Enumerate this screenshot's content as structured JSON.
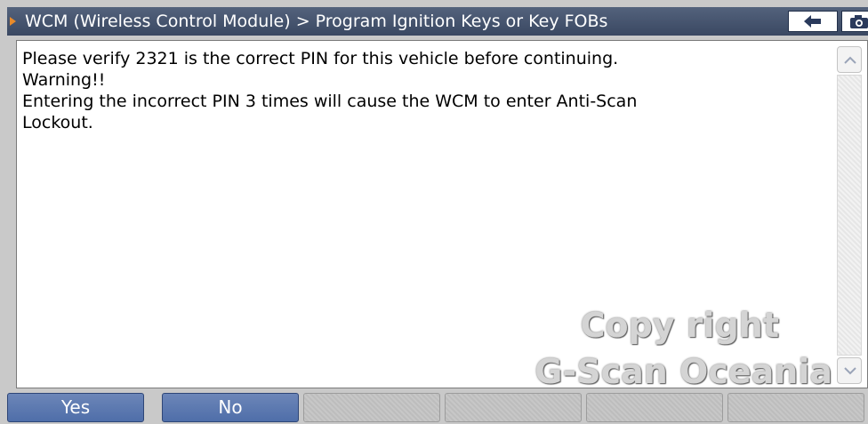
{
  "titlebar": {
    "title": "WCM (Wireless Control Module) > Program Ignition Keys or Key FOBs",
    "back_icon": "arrow-left-icon",
    "camera_icon": "camera-icon"
  },
  "message": {
    "lines": [
      "Please verify 2321 is the correct PIN for this vehicle before continuing.",
      "Warning!!",
      "Entering the incorrect PIN 3 times will cause the WCM to enter Anti-Scan",
      "Lockout."
    ]
  },
  "watermark": {
    "line1": "Copy right",
    "line2": "G-Scan Oceania"
  },
  "buttons": {
    "yes": "Yes",
    "no": "No"
  },
  "colors": {
    "titlebar": "#3a4862",
    "button_active": "#5a77ad",
    "accent_arrow": "#e88a2a"
  }
}
